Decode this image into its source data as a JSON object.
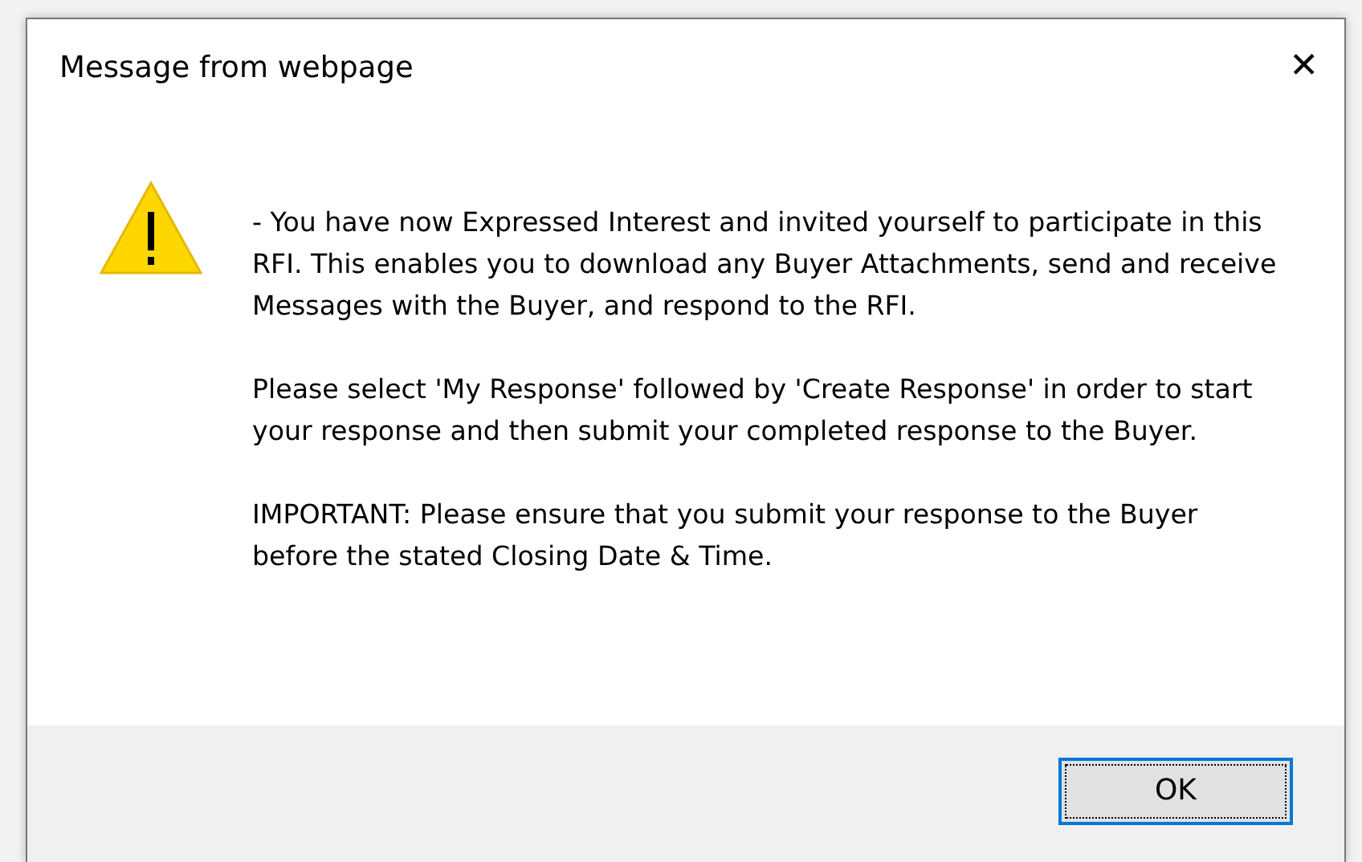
{
  "window": {
    "title": "Message from webpage",
    "close": "✕"
  },
  "message": {
    "kind": "warning",
    "paragraphs": [
      "- You have now Expressed Interest and invited yourself to participate in this RFI. This enables you to download any Buyer Attachments, send and receive Messages with the Buyer, and respond to the RFI.",
      "Please select 'My Response' followed by 'Create Response' in order to start your response and then submit your completed response to the Buyer.",
      "IMPORTANT: Please ensure that you submit your response to the Buyer before the stated Closing Date & Time."
    ]
  },
  "buttons": [
    {
      "label": "OK",
      "focused": true
    }
  ]
}
